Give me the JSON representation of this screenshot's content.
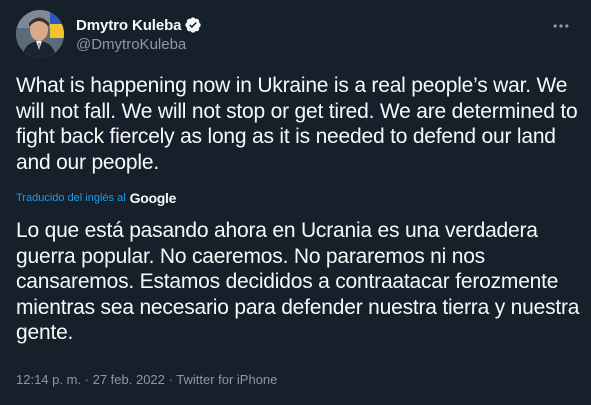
{
  "author": {
    "display_name": "Dmytro Kuleba",
    "handle": "@DmytroKuleba",
    "verified_icon": "verified-badge-icon"
  },
  "tweet": {
    "text": "What is happening now in Ukraine is a real people’s war. We will not fall. We will not stop or get tired. We are determined to fight back fiercely as long as it is needed to defend our land and our people.",
    "translation_note": "Traducido del inglés al",
    "translation_provider": "Google",
    "translated_text": "Lo que está pasando ahora en Ucrania es una verdadera guerra popular. No caeremos. No pararemos ni nos cansaremos. Estamos decididos a contraatacar ferozmente mientras sea necesario para defender nuestra tierra y nuestra gente."
  },
  "meta": {
    "time": "12:14 p. m.",
    "separator1": " · ",
    "date": "27 feb. 2022",
    "separator2": " · ",
    "source": "Twitter for iPhone"
  },
  "colors": {
    "background": "#15202b",
    "text": "#f7f9f9",
    "secondary": "#8b98a5",
    "accent": "#1d9bf0"
  }
}
